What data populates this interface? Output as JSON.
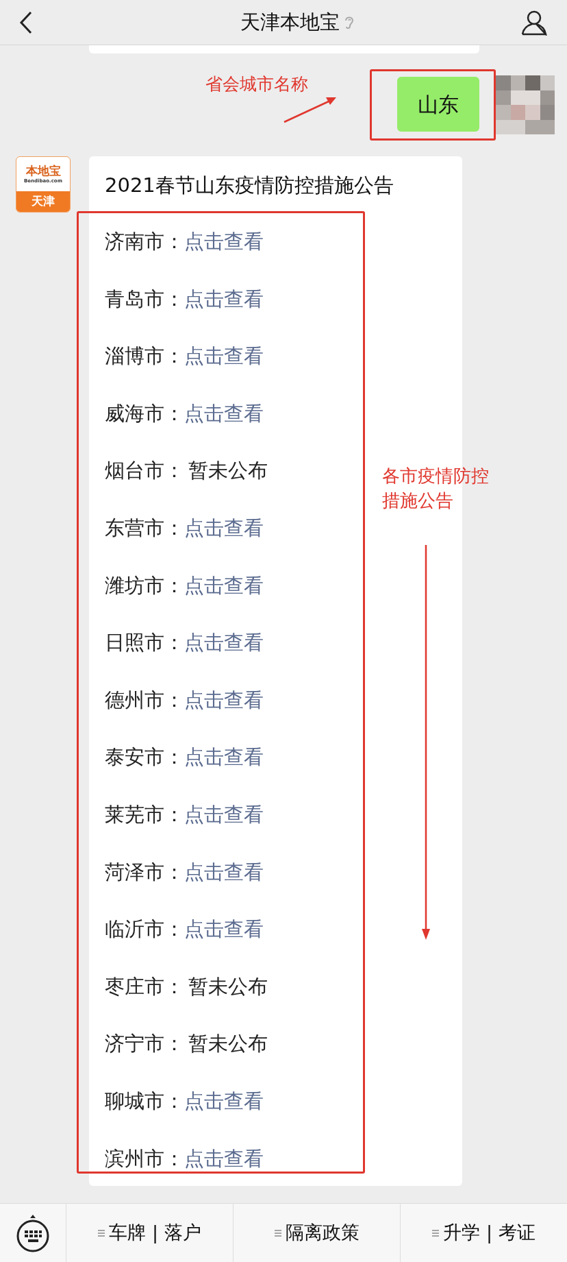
{
  "header": {
    "title": "天津本地宝"
  },
  "annotations": {
    "province_label": "省会城市名称",
    "list_label": "各市疫情防控措施公告"
  },
  "sent_message": {
    "text": "山东"
  },
  "logo": {
    "name": "本地宝",
    "url": "Bendibao.com",
    "city": "天津"
  },
  "reply": {
    "title": "2021春节山东疫情防控措施公告",
    "cities": [
      {
        "name": "济南市：",
        "value": "点击查看",
        "kind": "link"
      },
      {
        "name": "青岛市：",
        "value": "点击查看",
        "kind": "link"
      },
      {
        "name": "淄博市：",
        "value": "点击查看",
        "kind": "link"
      },
      {
        "name": "威海市：",
        "value": "点击查看",
        "kind": "link"
      },
      {
        "name": "烟台市：",
        "value": "暂未公布",
        "kind": "text"
      },
      {
        "name": "东营市：",
        "value": "点击查看",
        "kind": "link"
      },
      {
        "name": "潍坊市：",
        "value": "点击查看",
        "kind": "link"
      },
      {
        "name": "日照市：",
        "value": "点击查看",
        "kind": "link"
      },
      {
        "name": "德州市：",
        "value": "点击查看",
        "kind": "link"
      },
      {
        "name": "泰安市：",
        "value": "点击查看",
        "kind": "link"
      },
      {
        "name": "莱芜市：",
        "value": "点击查看",
        "kind": "link"
      },
      {
        "name": "菏泽市：",
        "value": "点击查看",
        "kind": "link"
      },
      {
        "name": "临沂市：",
        "value": "点击查看",
        "kind": "link"
      },
      {
        "name": "枣庄市：",
        "value": "暂未公布",
        "kind": "text"
      },
      {
        "name": "济宁市：",
        "value": "暂未公布",
        "kind": "text"
      },
      {
        "name": "聊城市：",
        "value": "点击查看",
        "kind": "link"
      },
      {
        "name": "滨州市：",
        "value": "点击查看",
        "kind": "link"
      }
    ]
  },
  "menu": [
    "车牌 | 落户",
    "隔离政策",
    "升学 | 考证"
  ]
}
